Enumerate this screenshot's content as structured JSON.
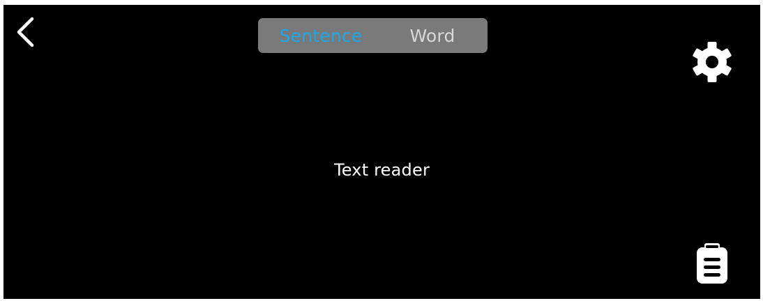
{
  "header": {
    "back_icon": "chevron-left-icon",
    "mode_tabs": [
      {
        "label": "Sentence",
        "selected": true
      },
      {
        "label": "Word",
        "selected": false
      }
    ],
    "settings_icon": "gear-icon"
  },
  "main": {
    "title": "Text reader"
  },
  "footer": {
    "clipboard_icon": "clipboard-icon"
  },
  "colors": {
    "background": "#000000",
    "accent": "#1ea7e8",
    "tab_bar": "#7a7a7a",
    "text": "#ffffff"
  }
}
